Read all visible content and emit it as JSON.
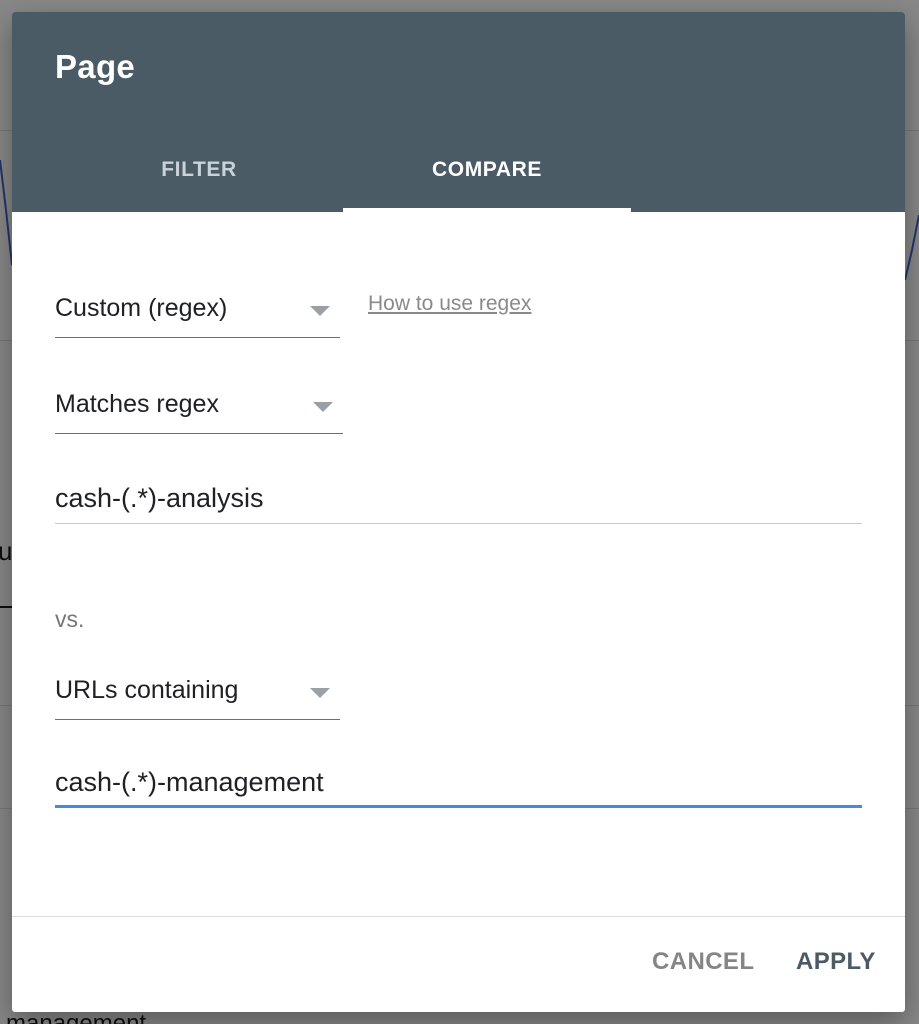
{
  "dialog": {
    "title": "Page",
    "tabs": [
      {
        "label": "FILTER",
        "selected": false
      },
      {
        "label": "COMPARE",
        "selected": true
      }
    ]
  },
  "form": {
    "match_type_select": {
      "value": "Custom (regex)"
    },
    "help_link": "How to use regex",
    "condition_select": {
      "value": "Matches regex"
    },
    "first_value": "cash-(.*)-analysis",
    "vs_label": "vs.",
    "second_condition_select": {
      "value": "URLs containing"
    },
    "second_value": "cash-(.*)-management"
  },
  "footer": {
    "cancel_label": "CANCEL",
    "apply_label": "APPLY"
  },
  "background": {
    "partial_text_left": "u",
    "partial_text_bottom": "management"
  },
  "colors": {
    "header": "#4b5b66",
    "active_input_underline": "#4a86e8",
    "apply_text": "#4b5b66",
    "cancel_text": "#858585"
  }
}
